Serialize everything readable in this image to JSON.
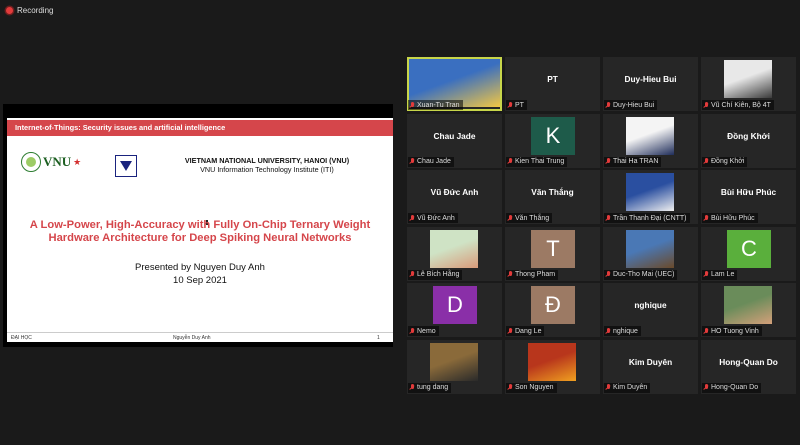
{
  "recording": {
    "label": "Recording",
    "icon": "recording-dot-icon"
  },
  "slide": {
    "header": "Internet-of-Things: Security issues and artificial intelligence",
    "logo_text": "VNU",
    "university": "VIETNAM NATIONAL UNIVERSITY, HANOI (VNU)",
    "institute": "VNU Information Technology Institute (ITI)",
    "title_line1": "A Low-Power, High-Accuracy with Fully On-Chip Ternary Weight",
    "title_line2": "Hardware Architecture for Deep Spiking Neural Networks",
    "presenter": "Presented by Nguyen Duy Anh",
    "date": "10 Sep 2021",
    "footer_left": "ĐẠI HỌC",
    "footer_center": "Nguyễn Duy Anh",
    "footer_page": "1"
  },
  "participants": [
    {
      "name": "Xuan-Tu Tran",
      "display": "",
      "letter": "",
      "type": "image",
      "colors": [
        "#3a6fc0",
        "#f2c744"
      ]
    },
    {
      "name": "PT",
      "display": "PT",
      "letter": "",
      "type": "name"
    },
    {
      "name": "Duy-Hieu Bui",
      "display": "Duy-Hieu Bui",
      "letter": "",
      "type": "name"
    },
    {
      "name": "Vũ Chí Kiên, Bộ 4T",
      "display": "",
      "letter": "",
      "type": "image",
      "colors": [
        "#e8e8e8",
        "#3a3a3a"
      ]
    },
    {
      "name": "Chau Jade",
      "display": "Chau Jade",
      "letter": "",
      "type": "name"
    },
    {
      "name": "Kien Thai Trung",
      "display": "",
      "letter": "K",
      "type": "letter",
      "color": "#1e5b4a"
    },
    {
      "name": "Thai Ha TRAN",
      "display": "",
      "letter": "",
      "type": "image",
      "colors": [
        "#f4f4f4",
        "#1f2d5a"
      ]
    },
    {
      "name": "Đồng Khởi",
      "display": "Đồng Khởi",
      "letter": "",
      "type": "name"
    },
    {
      "name": "Vũ Đức Anh",
      "display": "Vũ Đức Anh",
      "letter": "",
      "type": "name"
    },
    {
      "name": "Văn Thắng",
      "display": "Văn Thắng",
      "letter": "",
      "type": "name"
    },
    {
      "name": "Trần Thanh Đại (CNTT)",
      "display": "",
      "letter": "",
      "type": "image",
      "colors": [
        "#2a4fa0",
        "#f0f0f0"
      ]
    },
    {
      "name": "Bùi Hữu Phúc",
      "display": "Bùi Hữu Phúc",
      "letter": "",
      "type": "name"
    },
    {
      "name": "Lê Bích Hằng",
      "display": "",
      "letter": "",
      "type": "image",
      "colors": [
        "#cfe3c5",
        "#d89a7a"
      ]
    },
    {
      "name": "Thong Pham",
      "display": "",
      "letter": "T",
      "type": "letter",
      "color": "#9c7a64"
    },
    {
      "name": "Duc-Tho Mai (UEC)",
      "display": "",
      "letter": "",
      "type": "image",
      "colors": [
        "#4a78b5",
        "#6a4a2a"
      ]
    },
    {
      "name": "Lam Le",
      "display": "",
      "letter": "C",
      "type": "letter",
      "color": "#5aaf3c"
    },
    {
      "name": "Nemo",
      "display": "",
      "letter": "D",
      "type": "letter",
      "color": "#8a2fa8"
    },
    {
      "name": "Dang Le",
      "display": "",
      "letter": "Đ",
      "type": "letter",
      "color": "#9c7a64"
    },
    {
      "name": "nghique",
      "display": "nghique",
      "letter": "",
      "type": "name"
    },
    {
      "name": "HO Tuong Vinh",
      "display": "",
      "letter": "",
      "type": "image",
      "colors": [
        "#6a8c5a",
        "#d4a07a"
      ]
    },
    {
      "name": "tung dang",
      "display": "",
      "letter": "",
      "type": "image",
      "colors": [
        "#8a6a3a",
        "#2a2a2a"
      ]
    },
    {
      "name": "Son Nguyen",
      "display": "",
      "letter": "",
      "type": "image",
      "colors": [
        "#b8361c",
        "#f0a020"
      ]
    },
    {
      "name": "Kim Duyên",
      "display": "Kim Duyên",
      "letter": "",
      "type": "name"
    },
    {
      "name": "Hong-Quan Do",
      "display": "Hong-Quan Do",
      "letter": "",
      "type": "name"
    }
  ],
  "colors": {
    "background": "#1a1a1a",
    "tile": "#262626",
    "slide_accent": "#d5464b",
    "active_speaker": "#c8d64a",
    "muted_mic": "#e23b3b"
  }
}
